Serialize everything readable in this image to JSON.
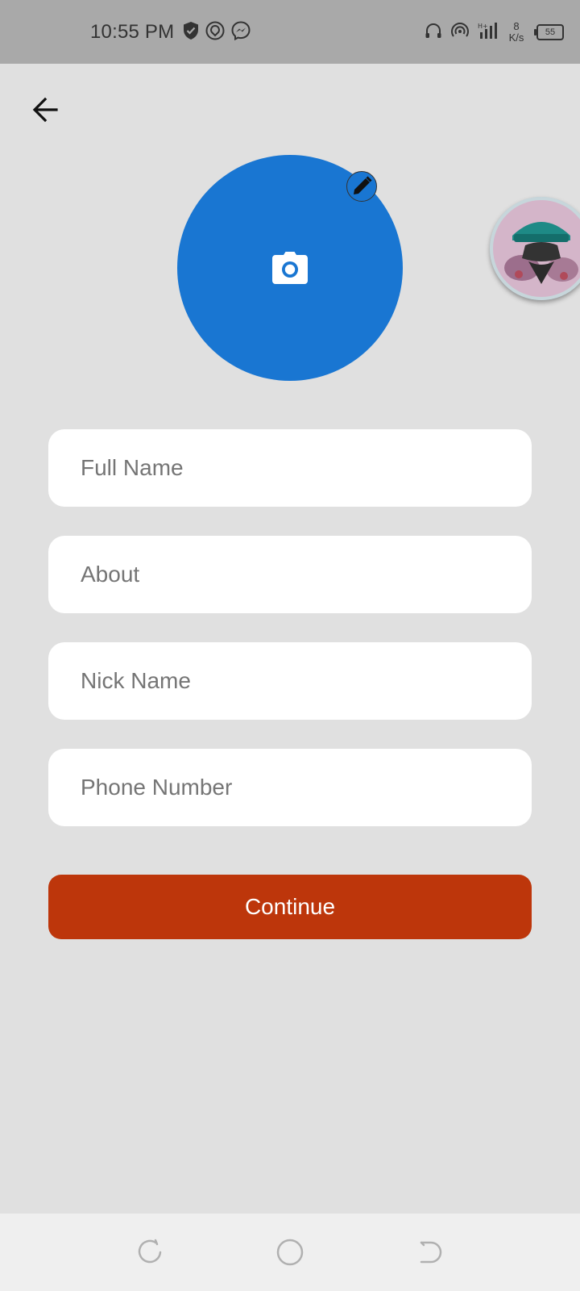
{
  "status_bar": {
    "time": "10:55 PM",
    "speed_value": "8",
    "speed_unit": "K/s",
    "battery_level": "55"
  },
  "form": {
    "full_name_placeholder": "Full Name",
    "about_placeholder": "About",
    "nick_name_placeholder": "Nick Name",
    "phone_number_placeholder": "Phone Number",
    "full_name_value": "",
    "about_value": "",
    "nick_name_value": "",
    "phone_number_value": "",
    "continue_label": "Continue"
  },
  "colors": {
    "avatar_bg": "#1976d2",
    "button_bg": "#bd360b",
    "page_bg": "#e0e0e0",
    "status_bar_bg": "#a9a9a9"
  },
  "icons": {
    "back": "arrow-back-icon",
    "camera": "camera-icon",
    "edit": "pencil-icon"
  }
}
